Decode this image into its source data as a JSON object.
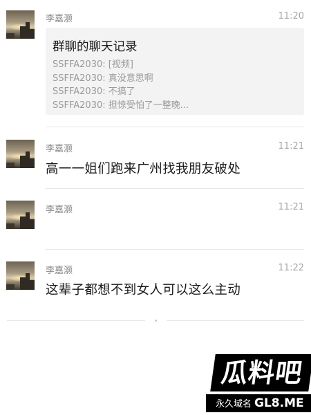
{
  "messages": [
    {
      "sender": "李嘉灏",
      "time": "11:20",
      "card": {
        "title": "群聊的聊天记录",
        "lines": [
          "SSFFA2030: [视频]",
          "SSFFA2030: 真没意思啊",
          "SSFFA2030: 不搞了",
          "SSFFA2030: 担惊受怕了一整晚..."
        ]
      }
    },
    {
      "sender": "李嘉灏",
      "time": "11:21",
      "text": "高一一姐们跑来广州找我朋友破处"
    },
    {
      "sender": "李嘉灏",
      "time": "11:21",
      "text": ""
    },
    {
      "sender": "李嘉灏",
      "time": "11:22",
      "text": "这辈子都想不到女人可以这么主动"
    }
  ],
  "watermark": {
    "logo_text": "瓜料吧",
    "tagline": "永久域名",
    "domain": "GL8.ME"
  }
}
